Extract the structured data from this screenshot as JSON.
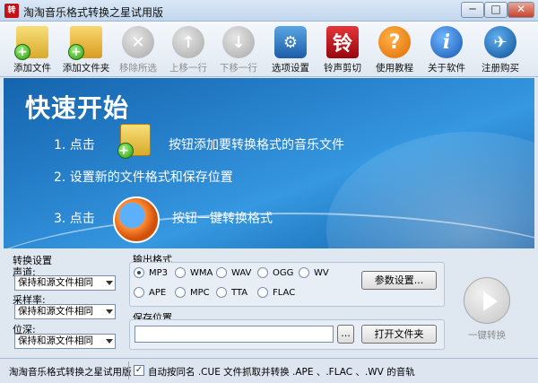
{
  "window": {
    "title": "淘淘音乐格式转换之星试用版",
    "icon_text": "转",
    "min_glyph": "─",
    "max_glyph": "□",
    "close_glyph": "✕"
  },
  "toolbar": {
    "items": [
      {
        "label": "添加文件",
        "icon": "add-file-icon",
        "enabled": true
      },
      {
        "label": "添加文件夹",
        "icon": "add-folder-icon",
        "enabled": true
      },
      {
        "label": "移除所选",
        "icon": "remove-icon",
        "enabled": false
      },
      {
        "label": "上移一行",
        "icon": "move-up-icon",
        "enabled": false
      },
      {
        "label": "下移一行",
        "icon": "move-down-icon",
        "enabled": false
      },
      {
        "label": "选项设置",
        "icon": "options-icon",
        "enabled": true
      },
      {
        "label": "铃声剪切",
        "icon": "ringtone-icon",
        "enabled": true,
        "glyph": "铃"
      },
      {
        "label": "使用教程",
        "icon": "help-icon",
        "enabled": true,
        "glyph": "?"
      },
      {
        "label": "关于软件",
        "icon": "about-icon",
        "enabled": true,
        "glyph": "i"
      },
      {
        "label": "注册购买",
        "icon": "buy-icon",
        "enabled": true
      }
    ]
  },
  "banner": {
    "title": "快速开始",
    "step1_prefix": "1. 点击",
    "step1_suffix": "按钮添加要转换格式的音乐文件",
    "step2": "2. 设置新的文件格式和保存位置",
    "step3_prefix": "3. 点击",
    "step3_suffix": "按钮一键转换格式"
  },
  "convert_settings": {
    "heading": "转换设置",
    "channel_label": "声道:",
    "channel_value": "保持和源文件相同",
    "samplerate_label": "采样率:",
    "samplerate_value": "保持和源文件相同",
    "bitdepth_label": "位深:",
    "bitdepth_value": "保持和源文件相同"
  },
  "output_format": {
    "heading": "输出格式",
    "options": [
      "MP3",
      "WMA",
      "WAV",
      "OGG",
      "WV",
      "APE",
      "MPC",
      "TTA",
      "FLAC"
    ],
    "selected": "MP3",
    "params_button": "参数设置..."
  },
  "save_location": {
    "heading": "保存位置",
    "path_value": "",
    "browse_button": "...",
    "open_folder_button": "打开文件夹"
  },
  "convert": {
    "label": "一键转换"
  },
  "status": {
    "text": "淘淘音乐格式转换之星试用版",
    "check_glyph": "✓",
    "checkbox_label": "自动按同名 .CUE 文件抓取并转换 .APE 、.FLAC 、.WV 的音轨",
    "checkbox_checked": true
  },
  "colors": {
    "banner": "#1e78c4",
    "disabled_text": "#8c8c8c"
  }
}
